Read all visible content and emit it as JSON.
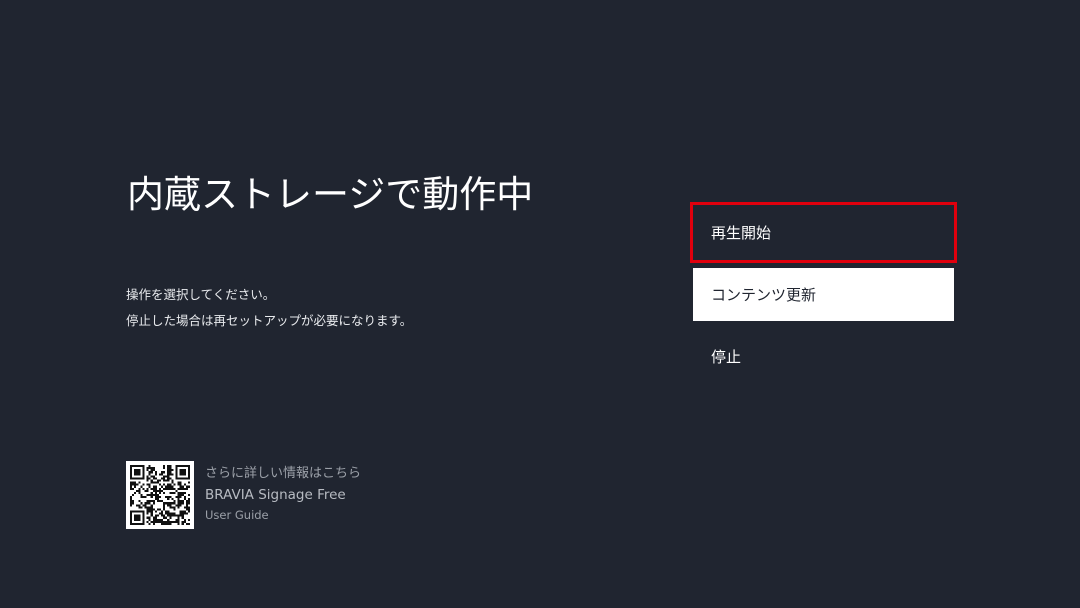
{
  "header": {
    "title": "内蔵ストレージで動作中"
  },
  "description": {
    "line1": "操作を選択してください。",
    "line2": "停止した場合は再セットアップが必要になります。"
  },
  "menu": {
    "items": [
      {
        "label": "再生開始",
        "state": "focused"
      },
      {
        "label": "コンテンツ更新",
        "state": "selected"
      },
      {
        "label": "停止",
        "state": "normal"
      }
    ]
  },
  "guide": {
    "line1": "さらに詳しい情報はこちら",
    "line2": "BRAVIA Signage Free",
    "line3": "User Guide",
    "icon": "qr-code-icon"
  },
  "colors": {
    "background": "#202530",
    "focus_border": "#e0000d",
    "selected_background": "#ffffff"
  }
}
